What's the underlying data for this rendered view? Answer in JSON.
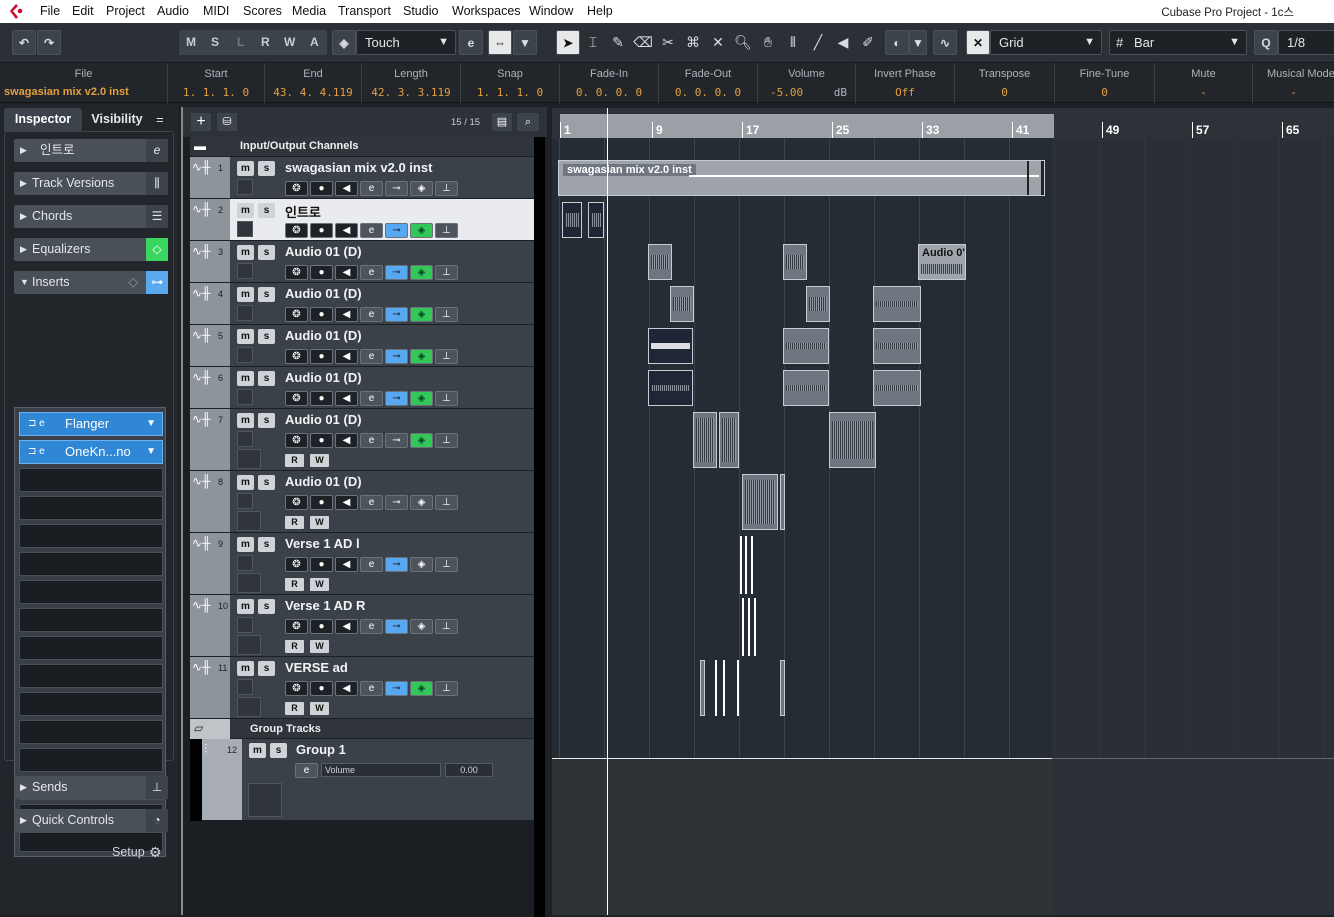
{
  "menu": {
    "items": [
      "File",
      "Edit",
      "Project",
      "Audio",
      "MIDI",
      "Scores",
      "Media",
      "Transport",
      "Studio",
      "Workspaces",
      "Window",
      "Help"
    ],
    "window_title": "Cubase Pro Project - 1c스"
  },
  "toolbar": {
    "state_buttons": [
      "M",
      "S",
      "L",
      "R",
      "W",
      "A"
    ],
    "automation_mode": "Touch",
    "grid_type": "Grid",
    "grid_unit": "Bar",
    "quantize": "1/8"
  },
  "infoline": [
    {
      "label": "File",
      "value": "swagasian mix v2.0  inst"
    },
    {
      "label": "Start",
      "value": "1. 1. 1.   0"
    },
    {
      "label": "End",
      "value": "43. 4. 4.119"
    },
    {
      "label": "Length",
      "value": "42. 3. 3.119"
    },
    {
      "label": "Snap",
      "value": "1. 1. 1.   0"
    },
    {
      "label": "Fade-In",
      "value": "0. 0. 0.   0"
    },
    {
      "label": "Fade-Out",
      "value": "0. 0. 0.   0"
    },
    {
      "label": "Volume",
      "value": "-5.00",
      "unit": "dB"
    },
    {
      "label": "Invert Phase",
      "value": "Off"
    },
    {
      "label": "Transpose",
      "value": "0"
    },
    {
      "label": "Fine-Tune",
      "value": "0"
    },
    {
      "label": "Mute",
      "value": "-"
    },
    {
      "label": "Musical Mode",
      "value": "-"
    }
  ],
  "inspector": {
    "tabs": [
      "Inspector",
      "Visibility"
    ],
    "sections": [
      "인트로",
      "Track Versions",
      "Chords",
      "Equalizers",
      "Inserts"
    ],
    "plugins": [
      "Flanger",
      "OneKn...no"
    ],
    "bottom_sections": [
      "Sends",
      "Quick Controls"
    ],
    "setup": "Setup"
  },
  "tracklist": {
    "count": "15 / 15"
  },
  "tracks": [
    {
      "num": "",
      "name": "Input/Output Channels"
    },
    {
      "num": "1",
      "name": "swagasian mix v2.0  inst"
    },
    {
      "num": "2",
      "name": "인트로"
    },
    {
      "num": "3",
      "name": "Audio 01 (D)"
    },
    {
      "num": "4",
      "name": "Audio 01 (D)"
    },
    {
      "num": "5",
      "name": "Audio 01 (D)"
    },
    {
      "num": "6",
      "name": "Audio 01 (D)"
    },
    {
      "num": "7",
      "name": "Audio 01 (D)"
    },
    {
      "num": "8",
      "name": "Audio 01 (D)"
    },
    {
      "num": "9",
      "name": "Verse 1 AD l"
    },
    {
      "num": "10",
      "name": "Verse 1 AD R"
    },
    {
      "num": "11",
      "name": "VERSE ad"
    },
    {
      "num": "",
      "name": "Group Tracks"
    },
    {
      "num": "12",
      "name": "Group 1"
    }
  ],
  "group_track": {
    "automation": "Volume",
    "value": "0.00"
  },
  "ruler": {
    "bars": [
      "1",
      "9",
      "17",
      "25",
      "33",
      "41",
      "49",
      "57",
      "65"
    ]
  },
  "events": {
    "main": "swagasian mix v2.0  inst",
    "audio_label": "Audio 0'"
  }
}
